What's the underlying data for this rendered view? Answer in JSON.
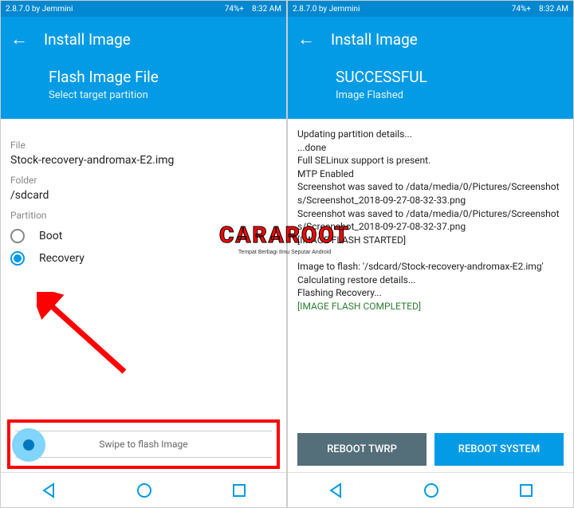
{
  "statusbar": {
    "left": "2.8.7.0 by Jemmini",
    "battery": "74%+",
    "time": "8:32 AM"
  },
  "appbar": {
    "title": "Install Image"
  },
  "left": {
    "header_title": "Flash Image File",
    "header_sub": "Select target partition",
    "file_label": "File",
    "file_value": "Stock-recovery-andromax-E2.img",
    "folder_label": "Folder",
    "folder_value": "/sdcard",
    "partition_label": "Partition",
    "radio_boot": "Boot",
    "radio_recovery": "Recovery",
    "swipe_text": "Swipe to flash Image"
  },
  "right": {
    "header_title": "SUCCESSFUL",
    "header_sub": "Image Flashed",
    "log_plain": "Updating partition details...\n...done\nFull SELinux support is present.\nMTP Enabled\nScreenshot was saved to /data/media/0/Pictures/Screenshots/Screenshot_2018-09-27-08-32-33.png\nScreenshot was saved to /data/media/0/Pictures/Screenshots/Screenshot_2018-09-27-08-32-37.png\n[IMAGE FLASH STARTED]\n\nImage to flash: '/sdcard/Stock-recovery-andromax-E2.img'\nCalculating restore details...\nFlashing Recovery...",
    "log_success": "[IMAGE FLASH COMPLETED]",
    "btn_twrp": "REBOOT TWRP",
    "btn_system": "REBOOT SYSTEM"
  },
  "watermark": {
    "main": "CARAROOT",
    "sub": "Tempat Berbagi Ilmu Seputar Android"
  }
}
